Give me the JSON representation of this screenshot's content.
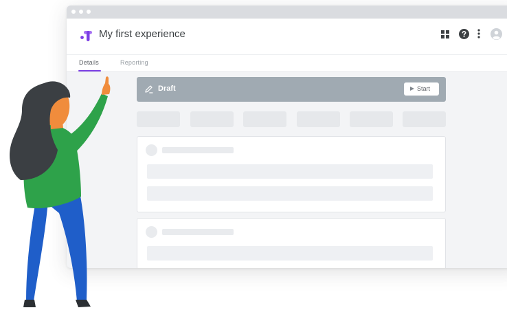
{
  "app": {
    "title": "My first experience",
    "logo_icon": "optimize-logo-icon",
    "accent_color": "#7b3fe4"
  },
  "header_icons": [
    "apps-grid-icon",
    "help-icon",
    "more-vert-icon",
    "account-avatar-icon"
  ],
  "tabs": [
    {
      "label": "Details",
      "active": true
    },
    {
      "label": "Reporting",
      "active": false
    }
  ],
  "status_bar": {
    "label": "Draft",
    "icon": "pencil-icon",
    "color": "#a0aab2",
    "start_button": {
      "label": "Start",
      "icon": "play-icon"
    }
  },
  "illustration": {
    "subject": "woman-pointing-up-illustration",
    "colors": {
      "hair": "#3b3f43",
      "skin": "#f08c3c",
      "top": "#2ea24a",
      "pants": "#1f5ec9"
    }
  }
}
